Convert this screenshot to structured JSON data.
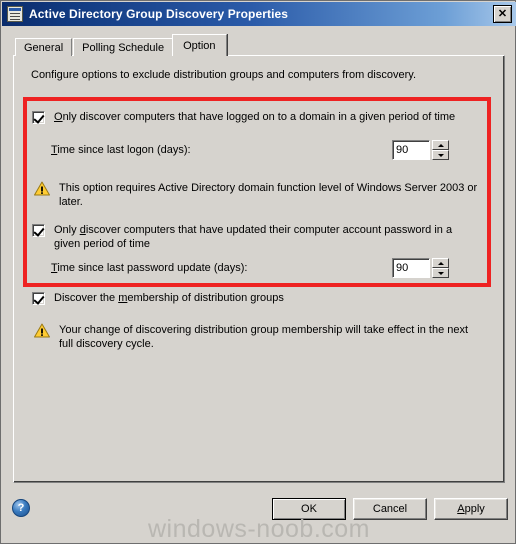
{
  "window": {
    "title": "Active Directory Group Discovery Properties",
    "icon": "properties-window-icon",
    "close_label": "✕"
  },
  "tabs": [
    {
      "label": "General",
      "active": false
    },
    {
      "label": "Polling Schedule",
      "active": false
    },
    {
      "label": "Option",
      "active": true
    }
  ],
  "content": {
    "intro": "Configure options to exclude distribution groups and computers from discovery.",
    "option_logon": {
      "checked": true,
      "accel": "O",
      "label_rest": "nly discover computers that have logged on to a domain in a given period of time",
      "spin_label_accel": "T",
      "spin_label_rest": "ime since last logon (days):",
      "spin_value": "90"
    },
    "warning_1": {
      "icon": "warning-triangle-icon",
      "text": "This option requires Active Directory domain function level of Windows Server 2003 or later."
    },
    "option_password": {
      "checked": true,
      "label_pre": "Only ",
      "accel": "d",
      "label_rest": "iscover computers that have updated their computer account password in a given period of time",
      "spin_label_accel": "T",
      "spin_label_rest": "ime since last password update (days):",
      "spin_value": "90"
    },
    "option_membership": {
      "checked": true,
      "label_pre": "Discover the ",
      "accel": "m",
      "label_rest": "embership of distribution groups"
    },
    "warning_2": {
      "icon": "warning-triangle-icon",
      "text": "Your change of discovering distribution group membership will take effect in the next full discovery cycle."
    }
  },
  "footer": {
    "help_label": "?",
    "ok_label": "OK",
    "cancel_label": "Cancel",
    "apply_accel": "A",
    "apply_rest": "pply"
  },
  "watermark": "windows-noob.com",
  "colors": {
    "titlebar_start": "#0a2b6b",
    "titlebar_end": "#a8c8ea",
    "dialog_face": "#d6d3ce",
    "highlight_red": "#ee2222",
    "warning_yellow": "#ffcc33",
    "watermark_gray": "#b9b7b2"
  }
}
